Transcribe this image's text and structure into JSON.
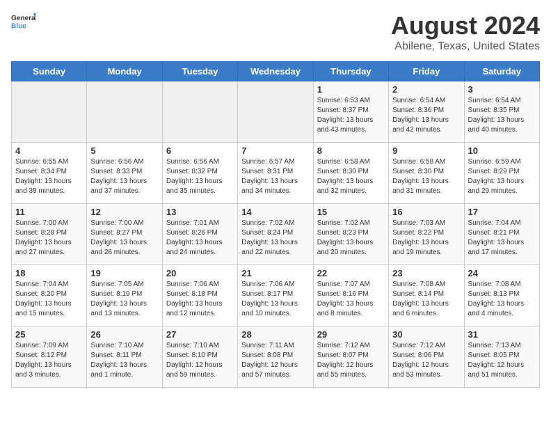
{
  "logo": {
    "line1": "General",
    "line2": "Blue"
  },
  "title": "August 2024",
  "subtitle": "Abilene, Texas, United States",
  "weekdays": [
    "Sunday",
    "Monday",
    "Tuesday",
    "Wednesday",
    "Thursday",
    "Friday",
    "Saturday"
  ],
  "weeks": [
    [
      {
        "day": "",
        "info": ""
      },
      {
        "day": "",
        "info": ""
      },
      {
        "day": "",
        "info": ""
      },
      {
        "day": "",
        "info": ""
      },
      {
        "day": "1",
        "info": "Sunrise: 6:53 AM\nSunset: 8:37 PM\nDaylight: 13 hours\nand 43 minutes."
      },
      {
        "day": "2",
        "info": "Sunrise: 6:54 AM\nSunset: 8:36 PM\nDaylight: 13 hours\nand 42 minutes."
      },
      {
        "day": "3",
        "info": "Sunrise: 6:54 AM\nSunset: 8:35 PM\nDaylight: 13 hours\nand 40 minutes."
      }
    ],
    [
      {
        "day": "4",
        "info": "Sunrise: 6:55 AM\nSunset: 8:34 PM\nDaylight: 13 hours\nand 39 minutes."
      },
      {
        "day": "5",
        "info": "Sunrise: 6:56 AM\nSunset: 8:33 PM\nDaylight: 13 hours\nand 37 minutes."
      },
      {
        "day": "6",
        "info": "Sunrise: 6:56 AM\nSunset: 8:32 PM\nDaylight: 13 hours\nand 35 minutes."
      },
      {
        "day": "7",
        "info": "Sunrise: 6:57 AM\nSunset: 8:31 PM\nDaylight: 13 hours\nand 34 minutes."
      },
      {
        "day": "8",
        "info": "Sunrise: 6:58 AM\nSunset: 8:30 PM\nDaylight: 13 hours\nand 32 minutes."
      },
      {
        "day": "9",
        "info": "Sunrise: 6:58 AM\nSunset: 8:30 PM\nDaylight: 13 hours\nand 31 minutes."
      },
      {
        "day": "10",
        "info": "Sunrise: 6:59 AM\nSunset: 8:29 PM\nDaylight: 13 hours\nand 29 minutes."
      }
    ],
    [
      {
        "day": "11",
        "info": "Sunrise: 7:00 AM\nSunset: 8:28 PM\nDaylight: 13 hours\nand 27 minutes."
      },
      {
        "day": "12",
        "info": "Sunrise: 7:00 AM\nSunset: 8:27 PM\nDaylight: 13 hours\nand 26 minutes."
      },
      {
        "day": "13",
        "info": "Sunrise: 7:01 AM\nSunset: 8:26 PM\nDaylight: 13 hours\nand 24 minutes."
      },
      {
        "day": "14",
        "info": "Sunrise: 7:02 AM\nSunset: 8:24 PM\nDaylight: 13 hours\nand 22 minutes."
      },
      {
        "day": "15",
        "info": "Sunrise: 7:02 AM\nSunset: 8:23 PM\nDaylight: 13 hours\nand 20 minutes."
      },
      {
        "day": "16",
        "info": "Sunrise: 7:03 AM\nSunset: 8:22 PM\nDaylight: 13 hours\nand 19 minutes."
      },
      {
        "day": "17",
        "info": "Sunrise: 7:04 AM\nSunset: 8:21 PM\nDaylight: 13 hours\nand 17 minutes."
      }
    ],
    [
      {
        "day": "18",
        "info": "Sunrise: 7:04 AM\nSunset: 8:20 PM\nDaylight: 13 hours\nand 15 minutes."
      },
      {
        "day": "19",
        "info": "Sunrise: 7:05 AM\nSunset: 8:19 PM\nDaylight: 13 hours\nand 13 minutes."
      },
      {
        "day": "20",
        "info": "Sunrise: 7:06 AM\nSunset: 8:18 PM\nDaylight: 13 hours\nand 12 minutes."
      },
      {
        "day": "21",
        "info": "Sunrise: 7:06 AM\nSunset: 8:17 PM\nDaylight: 13 hours\nand 10 minutes."
      },
      {
        "day": "22",
        "info": "Sunrise: 7:07 AM\nSunset: 8:16 PM\nDaylight: 13 hours\nand 8 minutes."
      },
      {
        "day": "23",
        "info": "Sunrise: 7:08 AM\nSunset: 8:14 PM\nDaylight: 13 hours\nand 6 minutes."
      },
      {
        "day": "24",
        "info": "Sunrise: 7:08 AM\nSunset: 8:13 PM\nDaylight: 13 hours\nand 4 minutes."
      }
    ],
    [
      {
        "day": "25",
        "info": "Sunrise: 7:09 AM\nSunset: 8:12 PM\nDaylight: 13 hours\nand 3 minutes."
      },
      {
        "day": "26",
        "info": "Sunrise: 7:10 AM\nSunset: 8:11 PM\nDaylight: 13 hours\nand 1 minute."
      },
      {
        "day": "27",
        "info": "Sunrise: 7:10 AM\nSunset: 8:10 PM\nDaylight: 12 hours\nand 59 minutes."
      },
      {
        "day": "28",
        "info": "Sunrise: 7:11 AM\nSunset: 8:08 PM\nDaylight: 12 hours\nand 57 minutes."
      },
      {
        "day": "29",
        "info": "Sunrise: 7:12 AM\nSunset: 8:07 PM\nDaylight: 12 hours\nand 55 minutes."
      },
      {
        "day": "30",
        "info": "Sunrise: 7:12 AM\nSunset: 8:06 PM\nDaylight: 12 hours\nand 53 minutes."
      },
      {
        "day": "31",
        "info": "Sunrise: 7:13 AM\nSunset: 8:05 PM\nDaylight: 12 hours\nand 51 minutes."
      }
    ]
  ]
}
